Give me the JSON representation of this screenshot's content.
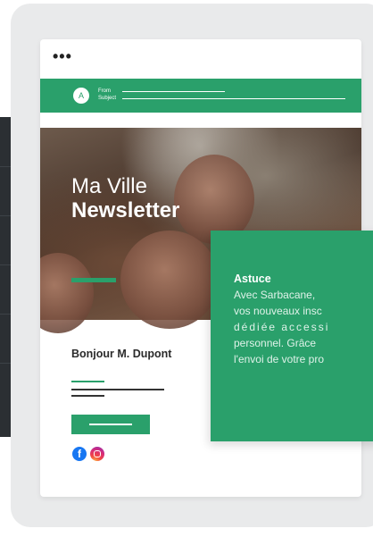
{
  "menu": {
    "dots": "•••"
  },
  "email": {
    "avatar_letter": "A",
    "from_label": "From",
    "subject_label": "Subject"
  },
  "hero": {
    "title_line1": "Ma Ville",
    "title_line2": "Newsletter"
  },
  "body": {
    "greeting": "Bonjour M. Dupont"
  },
  "social": {
    "facebook_glyph": "f"
  },
  "tip": {
    "title": "Astuce",
    "lines": [
      "Avec Sarbacane,",
      "vos nouveaux insc",
      "dédiée accessi",
      "personnel. Grâce",
      "l'envoi de votre pro"
    ]
  },
  "colors": {
    "accent_green": "#2aa06b",
    "device_bg": "#e9eaeb",
    "dark_panel": "#2b2f33",
    "facebook_blue": "#1877f2"
  },
  "icons": [
    "more-dots-icon",
    "avatar-icon",
    "facebook-icon",
    "instagram-icon"
  ]
}
